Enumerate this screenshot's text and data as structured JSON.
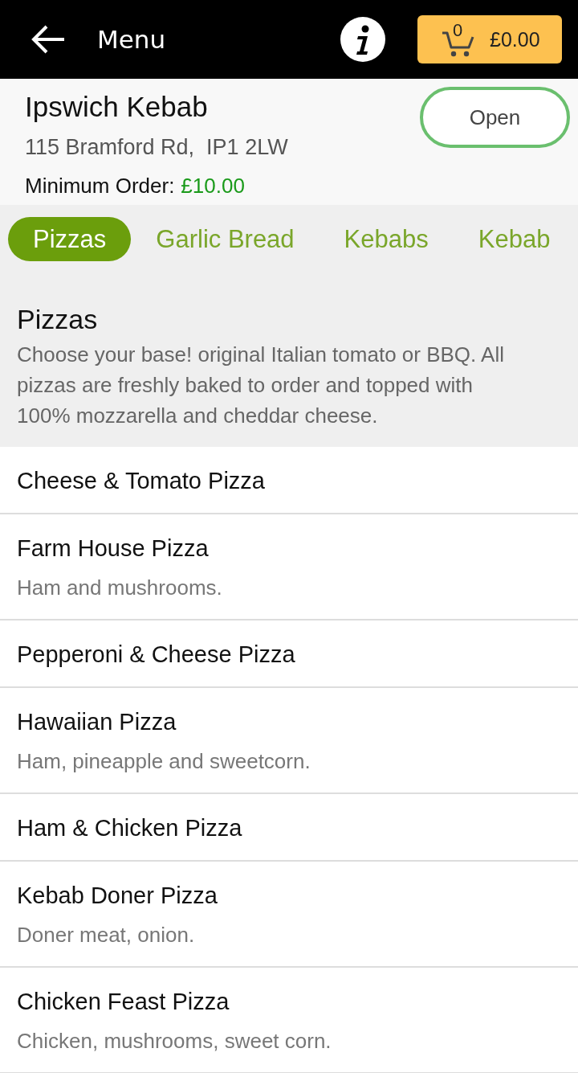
{
  "header": {
    "title": "Menu",
    "cart": {
      "count": "0",
      "total": "£0.00"
    }
  },
  "store": {
    "name": "Ipswich Kebab",
    "address": "115 Bramford Rd,  IP1 2LW",
    "minimum_order_label": "Minimum Order:",
    "minimum_order_value": "£10.00",
    "status": "Open"
  },
  "tabs": [
    {
      "label": "Pizzas",
      "selected": true
    },
    {
      "label": "Garlic Bread",
      "selected": false
    },
    {
      "label": "Kebabs",
      "selected": false
    },
    {
      "label": "Kebab",
      "selected": false
    }
  ],
  "section": {
    "title": "Pizzas",
    "description": "Choose your base! original Italian tomato or BBQ. All pizzas are freshly baked to order and topped with 100% mozzarella and cheddar cheese."
  },
  "items": [
    {
      "name": "Cheese & Tomato Pizza"
    },
    {
      "name": "Farm House Pizza",
      "description": "Ham and mushrooms."
    },
    {
      "name": "Pepperoni & Cheese Pizza"
    },
    {
      "name": "Hawaiian Pizza",
      "description": "Ham, pineapple and sweetcorn."
    },
    {
      "name": "Ham & Chicken Pizza"
    },
    {
      "name": "Kebab Doner Pizza",
      "description": "Doner meat, onion."
    },
    {
      "name": "Chicken Feast Pizza",
      "description": "Chicken, mushrooms, sweet corn."
    }
  ]
}
